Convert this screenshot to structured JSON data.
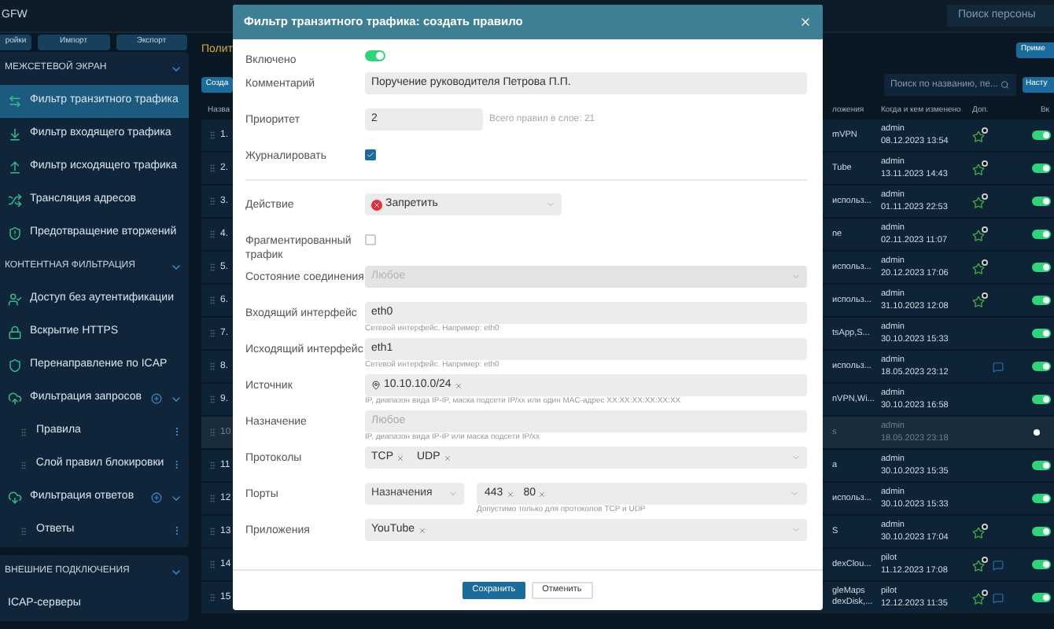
{
  "app": {
    "title": "GFW"
  },
  "person_search": {
    "placeholder": "Поиск персоны"
  },
  "toolbar": {
    "buttons": [
      "ройки",
      "Импорт",
      "Экспорт"
    ]
  },
  "page_title": "Полит",
  "apply_button": "Приме",
  "create_button": "Созда",
  "search": {
    "placeholder": "Поиск по названию, пе..."
  },
  "settings_button": "Насту",
  "sidebar": {
    "panels": [
      {
        "sections": [
          {
            "title": "МЕЖСЕТЕВОЙ ЭКРАН",
            "expanded": true,
            "items": [
              {
                "label": "Фильтр транзитного трафика",
                "selected": true
              },
              {
                "label": "Фильтр входящего трафика",
                "selected": false
              },
              {
                "label": "Фильтр исходящего трафика",
                "selected": false
              },
              {
                "label": "Трансляция адресов",
                "selected": false
              },
              {
                "label": "Предотвращение вторжений",
                "selected": false
              }
            ]
          },
          {
            "title": "КОНТЕНТНАЯ ФИЛЬТРАЦИЯ",
            "expanded": true,
            "items": [
              {
                "label": "Доступ без аутентификации",
                "selected": false
              },
              {
                "label": "Вскрытие HTTPS",
                "selected": false
              },
              {
                "label": "Перенаправление по ICAP",
                "selected": false
              },
              {
                "label": "Фильтрация запросов",
                "selected": false,
                "expanded": true,
                "children": [
                  {
                    "label": "Правила",
                    "selected": false
                  },
                  {
                    "label": "Слой правил блокировки",
                    "selected": false
                  }
                ]
              },
              {
                "label": "Фильтрация ответов",
                "selected": false,
                "expanded": true,
                "children": [
                  {
                    "label": "Ответы",
                    "selected": false
                  }
                ]
              }
            ]
          }
        ]
      },
      {
        "sections": [
          {
            "title": "ВНЕШНИЕ ПОДКЛЮЧЕНИЯ",
            "expanded": true,
            "items": [
              {
                "label": "ICAP-серверы",
                "selected": false
              }
            ]
          }
        ]
      }
    ]
  },
  "table": {
    "columns": [
      "Назва",
      "ложения",
      "Когда и кем изменено",
      "Доп.",
      "Вк"
    ],
    "rows": [
      {
        "number": "1.",
        "app": "mVPN",
        "user": "admin",
        "date": "08.12.2023 13:54",
        "star": true,
        "note": false,
        "enabled": true
      },
      {
        "number": "2.",
        "app": "Tube",
        "user": "admin",
        "date": "13.11.2023 14:43",
        "star": true,
        "note": false,
        "enabled": true
      },
      {
        "number": "3.",
        "app": "использ...",
        "user": "admin",
        "date": "01.11.2023 22:53",
        "star": true,
        "note": false,
        "enabled": true
      },
      {
        "number": "4.",
        "app": "ne",
        "user": "admin",
        "date": "02.11.2023 11:07",
        "star": true,
        "note": false,
        "enabled": true
      },
      {
        "number": "5.",
        "app": "использ...",
        "user": "admin",
        "date": "20.12.2023 17:06",
        "star": true,
        "note": false,
        "enabled": true
      },
      {
        "number": "6.",
        "app": "использ...",
        "user": "admin",
        "date": "31.10.2023 12:08",
        "star": true,
        "note": false,
        "enabled": true
      },
      {
        "number": "7.",
        "app": "tsApp,S...",
        "user": "admin",
        "date": "30.10.2023 15:33",
        "star": false,
        "note": false,
        "enabled": true
      },
      {
        "number": "8.",
        "app": "использ...",
        "user": "admin",
        "date": "18.05.2023 23:12",
        "star": false,
        "note": true,
        "enabled": true
      },
      {
        "number": "9.",
        "app": "nVPN,Wi...",
        "user": "admin",
        "date": "30.10.2023 16:58",
        "star": false,
        "note": false,
        "enabled": true
      },
      {
        "number": "10",
        "app": "s",
        "user": "admin",
        "date": "18.05.2023 23:18",
        "star": false,
        "note": false,
        "enabled": false
      },
      {
        "number": "11",
        "app": "a",
        "user": "admin",
        "date": "30.10.2023 15:35",
        "star": false,
        "note": false,
        "enabled": true
      },
      {
        "number": "12",
        "app": "использ...",
        "user": "admin",
        "date": "30.10.2023 15:33",
        "star": false,
        "note": false,
        "enabled": true
      },
      {
        "number": "13",
        "app": "S",
        "user": "admin",
        "date": "30.10.2023 17:04",
        "star": true,
        "note": false,
        "enabled": true
      },
      {
        "number": "14",
        "app": "dexClou...",
        "user": "pilot",
        "date": "11.12.2023 17:08",
        "star": true,
        "note": true,
        "enabled": true
      },
      {
        "number": "15",
        "app": "gleMaps dexDisk,...",
        "user": "pilot",
        "date": "12.12.2023 11:35",
        "star": true,
        "note": true,
        "enabled": true
      }
    ]
  },
  "dialog": {
    "title": "Фильтр транзитного трафика: создать правило",
    "sections": [
      {
        "fields": [
          {
            "kind": "toggle",
            "label": "Включено",
            "on": true
          },
          {
            "kind": "text",
            "label": "Комментарий",
            "value": "Поручение руководителя Петрова П.П."
          },
          {
            "kind": "number",
            "label": "Приоритет",
            "value": "2",
            "note": "Всего правил в слое: 21"
          },
          {
            "kind": "checkbox",
            "label": "Журналировать",
            "checked": true
          }
        ]
      },
      {
        "fields": [
          {
            "kind": "action",
            "label": "Действие",
            "value": "Запретить"
          },
          {
            "kind": "checkbox",
            "label": "Фрагментированный трафик",
            "checked": false
          },
          {
            "kind": "select",
            "label": "Состояние соединения",
            "placeholder": "Любое",
            "disabled": true
          },
          {
            "kind": "text",
            "label": "Входящий интерфейс",
            "value": "eth0",
            "hint": "Сетевой интерфейс. Например: eth0"
          },
          {
            "kind": "text",
            "label": "Исходящий интерфейс",
            "value": "eth1",
            "hint": "Сетевой интерфейс. Например: eth0"
          },
          {
            "kind": "tags",
            "label": "Источник",
            "tags": [
              {
                "text": "10.10.10.0/24",
                "kind": "address"
              }
            ],
            "dropdown": false,
            "hint": "IP, диапазон вида IP-IP, маска подсети IP/xx или один MAC-адрес XX:XX:XX:XX:XX:XX"
          },
          {
            "kind": "text",
            "label": "Назначение",
            "placeholder": "Любое",
            "hint": "IP, диапазон вида IP-IP или маска подсети IP/xx"
          },
          {
            "kind": "tags",
            "label": "Протоколы",
            "tags": [
              {
                "text": "TCP",
                "kind": "plain"
              },
              {
                "text": "UDP",
                "kind": "plain"
              }
            ],
            "dropdown": true
          },
          {
            "kind": "ports",
            "label": "Порты",
            "direction": "Назначения",
            "tags": [
              {
                "text": "443",
                "kind": "plain"
              },
              {
                "text": "80",
                "kind": "plain"
              }
            ],
            "hint": "Допустимо только для протоколов TCP и UDP"
          },
          {
            "kind": "tags",
            "label": "Приложения",
            "tags": [
              {
                "text": "YouTube",
                "kind": "plain"
              }
            ],
            "dropdown": true
          }
        ]
      }
    ],
    "buttons": [
      {
        "label": "Сохранить",
        "primary": true
      },
      {
        "label": "Отменить",
        "primary": false
      }
    ]
  }
}
